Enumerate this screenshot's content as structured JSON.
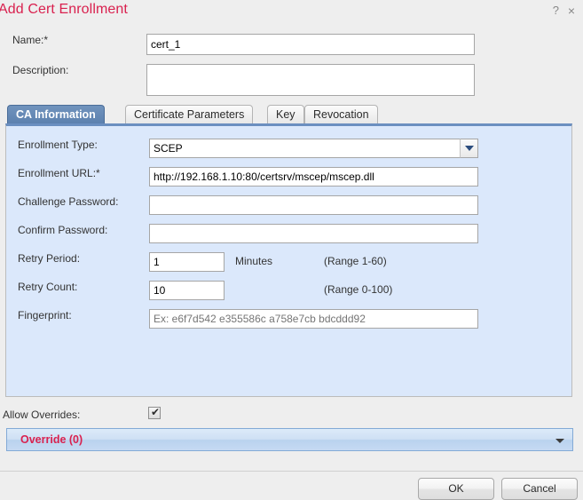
{
  "header": {
    "title": "Add Cert Enrollment",
    "help_icon": "?",
    "close_icon": "×"
  },
  "top_form": {
    "name_label": "Name:*",
    "name_value": "cert_1",
    "description_label": "Description:",
    "description_value": ""
  },
  "tabs": [
    {
      "label": "CA Information",
      "active": true
    },
    {
      "label": "Certificate Parameters",
      "active": false
    },
    {
      "label": "Key",
      "active": false
    },
    {
      "label": "Revocation",
      "active": false
    }
  ],
  "ca_information": {
    "enrollment_type_label": "Enrollment Type:",
    "enrollment_type_value": "SCEP",
    "enrollment_url_label": "Enrollment URL:*",
    "enrollment_url_value": "http://192.168.1.10:80/certsrv/mscep/mscep.dll",
    "challenge_password_label": "Challenge Password:",
    "challenge_password_value": "",
    "confirm_password_label": "Confirm Password:",
    "confirm_password_value": "",
    "retry_period_label": "Retry Period:",
    "retry_period_value": "1",
    "retry_period_unit": "Minutes",
    "retry_period_range": "(Range 1-60)",
    "retry_count_label": "Retry Count:",
    "retry_count_value": "10",
    "retry_count_range": "(Range 0-100)",
    "fingerprint_label": "Fingerprint:",
    "fingerprint_placeholder": "Ex: e6f7d542 e355586c a758e7cb bdcddd92",
    "fingerprint_value": ""
  },
  "overrides": {
    "allow_overrides_label": "Allow Overrides:",
    "allow_overrides_checked": true,
    "checkbox_glyph": "✔",
    "override_label": "Override (0)"
  },
  "footer": {
    "ok_label": "OK",
    "cancel_label": "Cancel"
  },
  "colors": {
    "title_red": "#d9214f",
    "panel_blue": "#dbe8fb",
    "active_tab_blue": "#5c80ae",
    "page_bg": "#eeeeee"
  }
}
